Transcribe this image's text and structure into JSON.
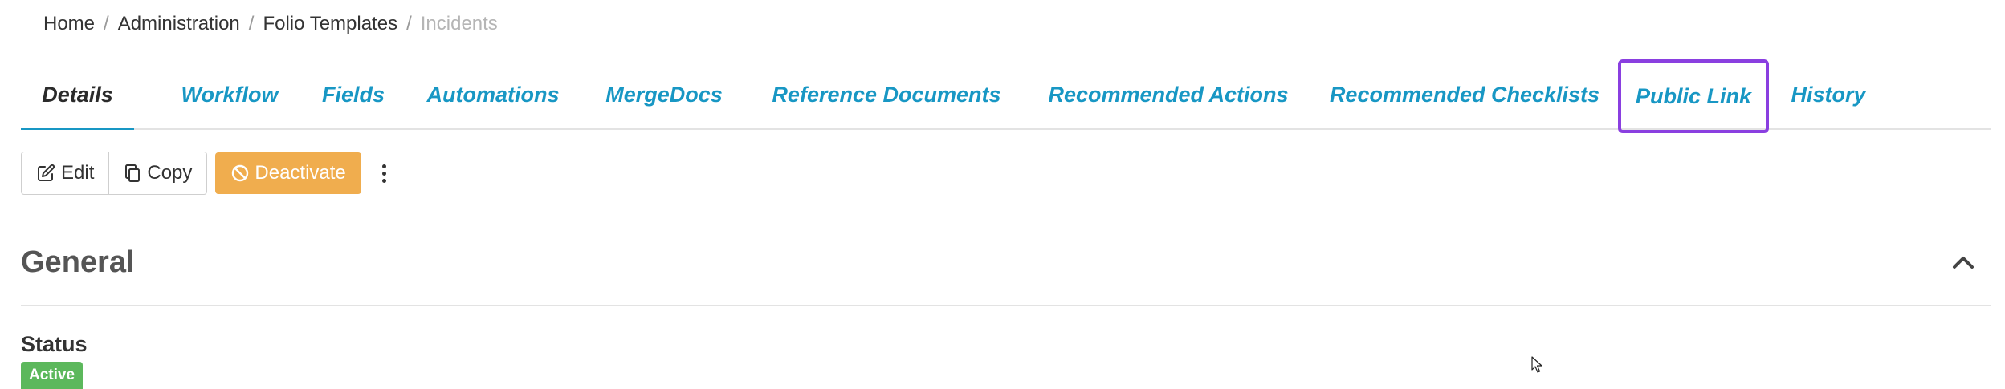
{
  "breadcrumb": {
    "items": [
      {
        "label": "Home"
      },
      {
        "label": "Administration"
      },
      {
        "label": "Folio Templates"
      }
    ],
    "separator": "/",
    "current": "Incidents"
  },
  "tabs": [
    {
      "label": "Details",
      "active": true
    },
    {
      "label": "Workflow"
    },
    {
      "label": "Fields"
    },
    {
      "label": "Automations"
    },
    {
      "label": "MergeDocs"
    },
    {
      "label": "Reference Documents"
    },
    {
      "label": "Recommended Actions"
    },
    {
      "label": "Recommended Checklists"
    },
    {
      "label": "Public Link",
      "highlighted": true
    },
    {
      "label": "History"
    }
  ],
  "toolbar": {
    "edit_label": "Edit",
    "copy_label": "Copy",
    "deactivate_label": "Deactivate"
  },
  "section": {
    "title": "General"
  },
  "status": {
    "label": "Status",
    "value": "Active"
  },
  "icons": {
    "edit": "edit-icon",
    "copy": "copy-icon",
    "deactivate": "ban-icon",
    "more": "kebab-menu-icon",
    "collapse": "chevron-up-icon"
  },
  "colors": {
    "tab_link": "#1897c4",
    "highlight_border": "#8a3fe0",
    "warning": "#f0ad4e",
    "success": "#5cb85c"
  }
}
